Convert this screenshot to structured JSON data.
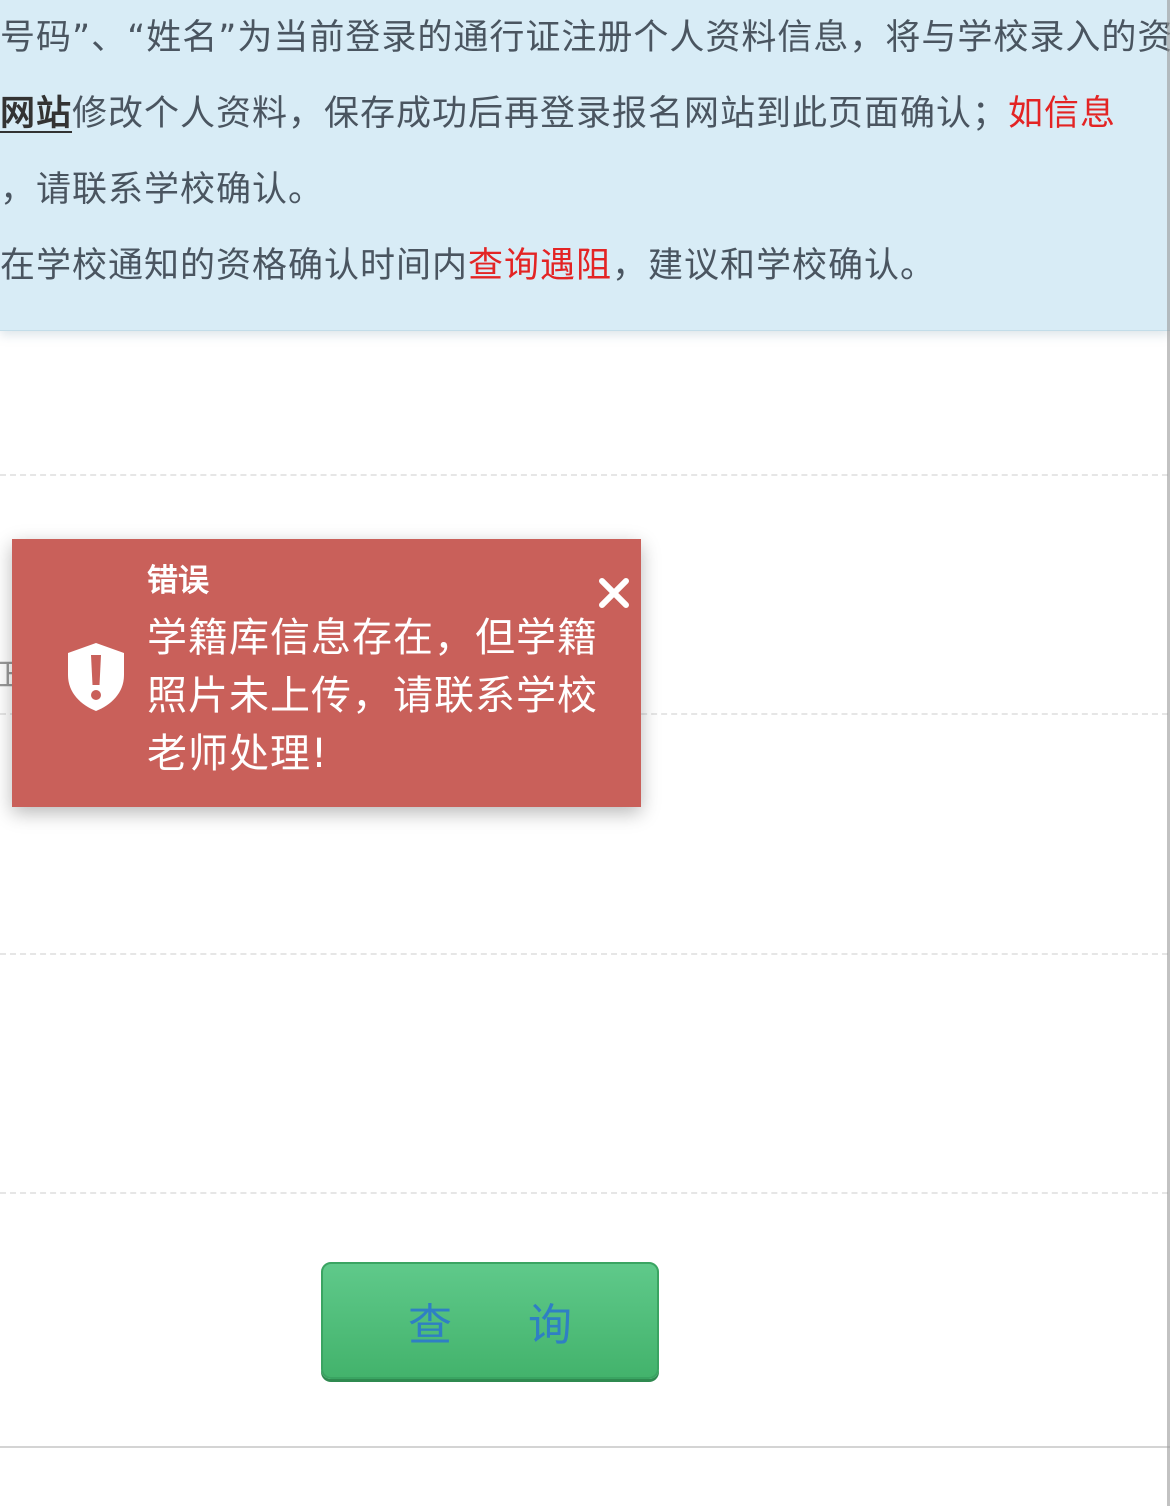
{
  "notice": {
    "line1": "号码”、“姓名”为当前登录的通行证注册个人资料信息，将与学校录入的资",
    "line2_link": "网站",
    "line2_text": "修改个人资料，保存成功后再登录报名网站到此页面确认；",
    "line2_red": "如信息",
    "line3": "，请联系学校确认。",
    "line4_prefix": "在学校通知的资格确认时间内",
    "line4_red": "查询遇阻",
    "line4_suffix": "，建议和学校确认。"
  },
  "form": {
    "label_fragment": "正"
  },
  "toast": {
    "title": "错误",
    "message": "学籍库信息存在，但学籍照片未上传，请联系学校老师处理!",
    "close_label": "×",
    "icon": "shield-alert-icon"
  },
  "query_button": {
    "label": "查询"
  },
  "colors": {
    "notice_bg": "#d8ecf6",
    "toast_bg": "#c9605a",
    "button_green": "#4cbc76",
    "highlight_red": "#e32424"
  }
}
